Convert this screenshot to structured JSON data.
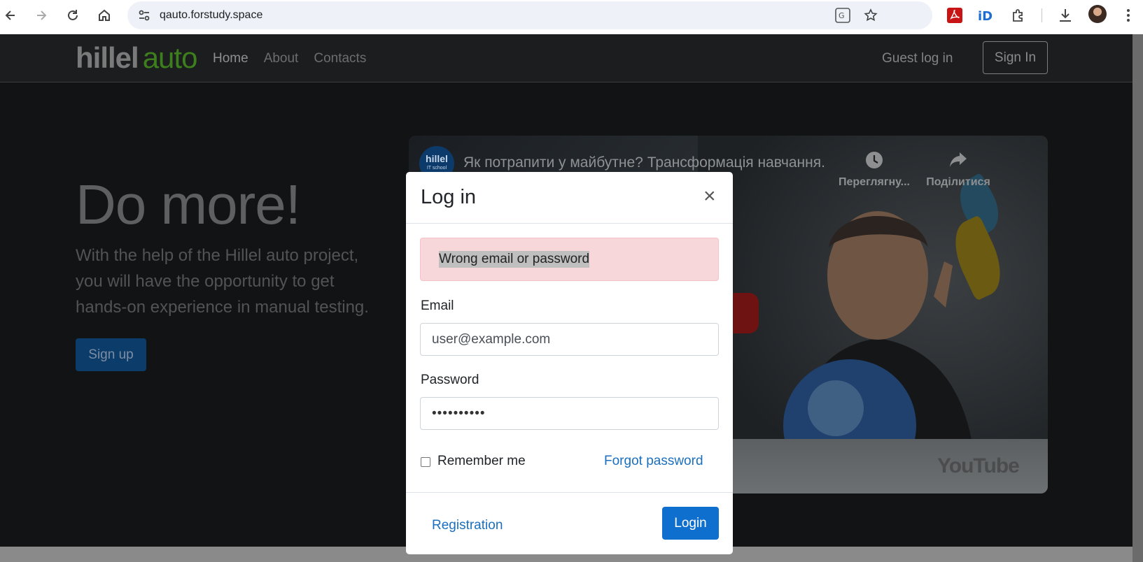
{
  "browser": {
    "url": "qauto.forstudy.space",
    "icons": [
      "back-icon",
      "forward-icon",
      "reload-icon",
      "home-icon",
      "site-settings-icon",
      "translate-icon",
      "star-icon",
      "pdf-extension-icon",
      "id-extension-icon",
      "puzzle-icon",
      "download-icon",
      "profile-avatar",
      "more-menu-icon"
    ]
  },
  "site": {
    "logo_part1": "hillel",
    "logo_part2": "auto",
    "nav": {
      "home": "Home",
      "about": "About",
      "contacts": "Contacts"
    },
    "guest_login": "Guest log in",
    "sign_in": "Sign In",
    "hero": {
      "title": "Do more!",
      "subtitle": "With the help of the Hillel auto project, you will have the opportunity to get hands-on experience in manual testing.",
      "signup": "Sign up"
    },
    "video": {
      "channel_name": "hillel",
      "channel_sub": "IT school",
      "title": "Як потрапити у майбутне? Трансформація навчання.",
      "watch_later": "Переглягну...",
      "share": "Поділитися",
      "platform": "YouTube"
    }
  },
  "modal": {
    "title": "Log in",
    "close": "×",
    "error": "Wrong email or password",
    "email_label": "Email",
    "email_value": "user@example.com",
    "password_label": "Password",
    "password_value": "••••••••••",
    "remember_me": "Remember me",
    "forgot_password": "Forgot password",
    "registration": "Registration",
    "login": "Login"
  },
  "colors": {
    "accent_blue": "#0f6fcf",
    "error_bg": "#f8d7da",
    "logo_green": "#3d7f1d"
  }
}
